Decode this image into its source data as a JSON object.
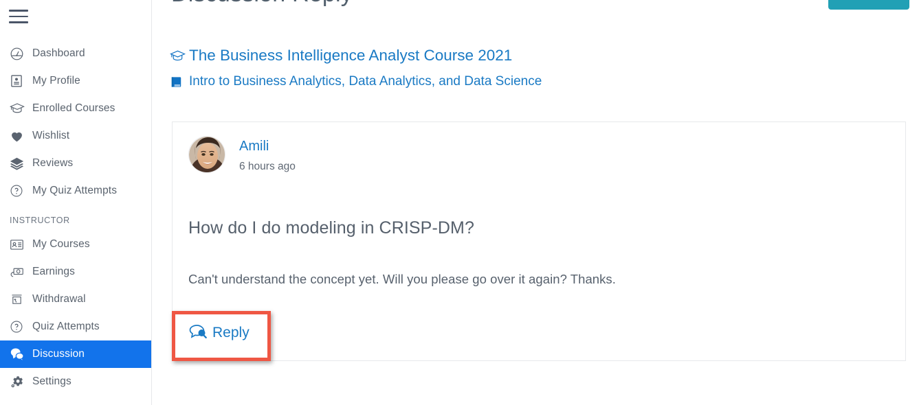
{
  "sidebar": {
    "menu_icon": "hamburger-icon",
    "items": [
      {
        "label": "Dashboard",
        "icon": "dashboard-icon",
        "active": false
      },
      {
        "label": "My Profile",
        "icon": "id-card-icon",
        "active": false
      },
      {
        "label": "Enrolled Courses",
        "icon": "graduation-cap-icon",
        "active": false
      },
      {
        "label": "Wishlist",
        "icon": "heart-icon",
        "active": false
      },
      {
        "label": "Reviews",
        "icon": "layers-icon",
        "active": false
      },
      {
        "label": "My Quiz Attempts",
        "icon": "question-circle-icon",
        "active": false
      }
    ],
    "section_label": "INSTRUCTOR",
    "instructor_items": [
      {
        "label": "My Courses",
        "icon": "course-card-icon",
        "active": false
      },
      {
        "label": "Earnings",
        "icon": "money-hand-icon",
        "active": false
      },
      {
        "label": "Withdrawal",
        "icon": "withdraw-icon",
        "active": false
      },
      {
        "label": "Quiz Attempts",
        "icon": "question-circle-icon",
        "active": false
      },
      {
        "label": "Discussion",
        "icon": "chat-bubbles-icon",
        "active": true
      },
      {
        "label": "Settings",
        "icon": "gear-icon",
        "active": false
      }
    ],
    "active_color": "#1273eb"
  },
  "header": {
    "title": "Discussion Reply",
    "action_button_label": "",
    "action_button_color": "#21a0b5"
  },
  "breadcrumbs": {
    "course": {
      "label": "The Business Intelligence Analyst Course 2021",
      "icon": "graduation-cap-icon"
    },
    "lesson": {
      "label": "Intro to Business Analytics, Data Analytics, and Data Science",
      "icon": "book-icon"
    },
    "link_color": "#1a7ac4"
  },
  "discussion": {
    "author": "Amili",
    "timestamp": "6 hours ago",
    "title": "How do I do modeling in CRISP-DM?",
    "body": "Can't understand the concept yet. Will you please go over it again? Thanks.",
    "reply_label": "Reply",
    "reply_icon": "reply-chat-icon",
    "highlight_color": "#ef5744"
  }
}
